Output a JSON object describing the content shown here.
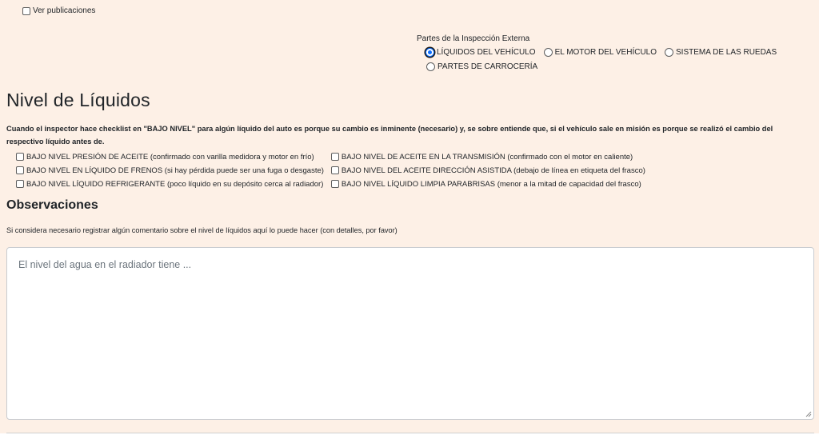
{
  "ver_publicaciones": {
    "label": "Ver publicaciones",
    "checked": false
  },
  "radio_group": {
    "label": "Partes de la Inspección Externa",
    "options": [
      {
        "label": "LÍQUIDOS DEL VEHÍCULO",
        "checked": true
      },
      {
        "label": "EL MOTOR DEL VEHÍCULO",
        "checked": false
      },
      {
        "label": "SISTEMA DE LAS RUEDAS",
        "checked": false
      },
      {
        "label": "PARTES DE CARROCERÍA",
        "checked": false
      }
    ]
  },
  "section": {
    "title": "Nivel de Líquidos",
    "description": "Cuando el inspector hace checklist en \"BAJO NIVEL\" para algún líquido del auto es porque su cambio es inminente (necesario) y, se sobre entiende que, si el vehículo sale en misión es porque se realizó el cambio del respectivo líquido antes de."
  },
  "checklist": [
    {
      "label": "BAJO NIVEL PRESIÓN DE ACEITE (confirmado con varilla medidora y motor en frío)",
      "checked": false
    },
    {
      "label": "BAJO NIVEL DE ACEITE EN LA TRANSMISIÓN (confirmado con el motor en caliente)",
      "checked": false
    },
    {
      "label": "BAJO NIVEL EN LÍQUIDO DE FRENOS (si hay pérdida puede ser una fuga o desgaste)",
      "checked": false
    },
    {
      "label": "BAJO NIVEL DEL ACEITE DIRECCIÓN ASISTIDA (debajo de línea en etiqueta del frasco)",
      "checked": false
    },
    {
      "label": "BAJO NIVEL LÍQUIDO REFRIGERANTE (poco líquido en su depósito cerca al radiador)",
      "checked": false
    },
    {
      "label": "BAJO NIVEL LÍQUIDO LIMPIA PARABRISAS (menor a la mitad de capacidad del frasco)",
      "checked": false
    }
  ],
  "observaciones": {
    "title": "Observaciones",
    "help": "Si considera necesario registrar algún comentario sobre el nivel de líquidos aquí lo puede hacer (con detalles, por favor)",
    "placeholder": "El nivel del agua en el radiador tiene ...",
    "value": ""
  },
  "colors": {
    "panel_bg": "#fdf0e6",
    "accent": "#0d6efd",
    "text": "#212529",
    "placeholder": "#6c757d"
  }
}
